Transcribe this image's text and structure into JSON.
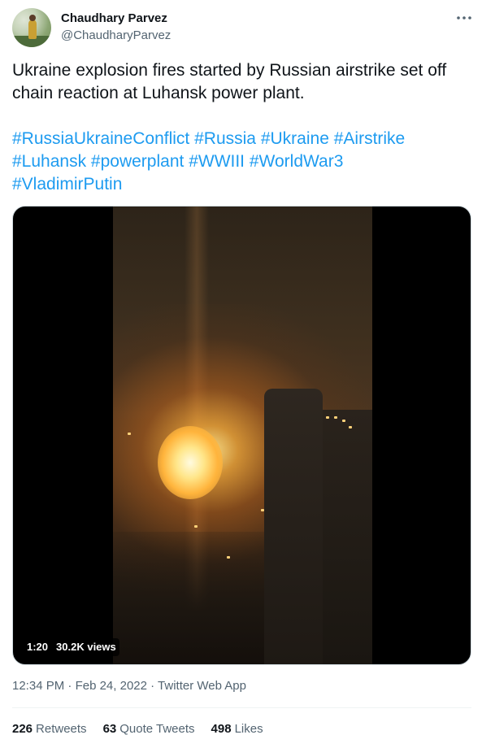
{
  "author": {
    "display_name": "Chaudhary Parvez",
    "handle": "@ChaudharyParvez"
  },
  "tweet": {
    "text": "Ukraine explosion fires started by Russian airstrike set off chain reaction at Luhansk power plant.",
    "hashtags": [
      "#RussiaUkraineConflict",
      "#Russia",
      "#Ukraine",
      "#Airstrike",
      "#Luhansk",
      "#powerplant",
      "#WWIII",
      "#WorldWar3",
      "#VladimirPutin"
    ]
  },
  "media": {
    "type": "video",
    "duration": "1:20",
    "views": "30.2K views"
  },
  "meta": {
    "time": "12:34 PM",
    "separator": "·",
    "date": "Feb 24, 2022",
    "source": "Twitter Web App"
  },
  "stats": {
    "retweets_count": "226",
    "retweets_label": "Retweets",
    "quotes_count": "63",
    "quotes_label": "Quote Tweets",
    "likes_count": "498",
    "likes_label": "Likes"
  },
  "colors": {
    "link": "#1d9bf0",
    "text": "#0f1419",
    "secondary": "#536471"
  },
  "icons": {
    "more": "more-horizontal-icon"
  }
}
